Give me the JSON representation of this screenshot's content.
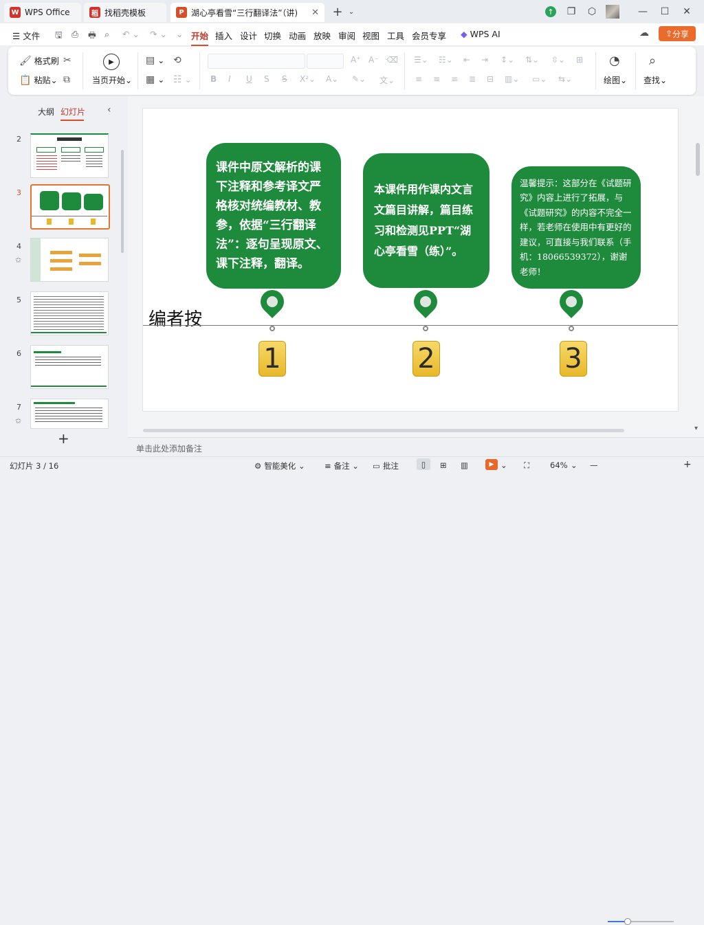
{
  "tabs": [
    {
      "label": "WPS Office",
      "icon": "wps-logo-icon",
      "color": "#d0342c"
    },
    {
      "label": "找稻壳模板",
      "icon": "docer-icon",
      "color": "#d0342c"
    },
    {
      "label": "湖心亭看雪“三行翻译法”（讲)",
      "icon": "ppt-icon",
      "color": "#d4502a"
    }
  ],
  "menu": {
    "file": "文件",
    "items": [
      "开始",
      "插入",
      "设计",
      "切换",
      "动画",
      "放映",
      "审阅",
      "视图",
      "工具",
      "会员专享"
    ],
    "ai": "WPS AI",
    "share": "分享"
  },
  "ribbon": {
    "format_painter": "格式刷",
    "paste": "粘贴",
    "play_from_current": "当页开始",
    "draw": "绘图",
    "find": "查找"
  },
  "left_panel": {
    "outline_tab": "大纲",
    "slides_tab": "幻灯片",
    "slide_numbers": [
      "2",
      "3",
      "4",
      "5",
      "6",
      "7"
    ],
    "add": "+"
  },
  "slide": {
    "title": "编者按",
    "bubbles": [
      "课件中原文解析的课下注释和参考译文严格核对统编教材、教参，依据“三行翻译法”：逐句呈现原文、课下注释，翻译。",
      "本课件用作课内文言文篇目讲解，篇目练习和检测见PPT“湖心亭看雪（练）”。",
      "温馨提示：这部分在《试题研究》内容上进行了拓展，与《试题研究》的内容不完全一样，若老师在使用中有更好的建议，可直接与我们联系（手机：18066539372），谢谢老师！"
    ],
    "numbers": [
      "1",
      "2",
      "3"
    ],
    "accent": "#1e8a3c"
  },
  "notes_placeholder": "单击此处添加备注",
  "status": {
    "slide_counter": "幻灯片 3 / 16",
    "smart_beautify": "智能美化",
    "notes": "备注",
    "comments": "批注",
    "zoom": "64%"
  }
}
